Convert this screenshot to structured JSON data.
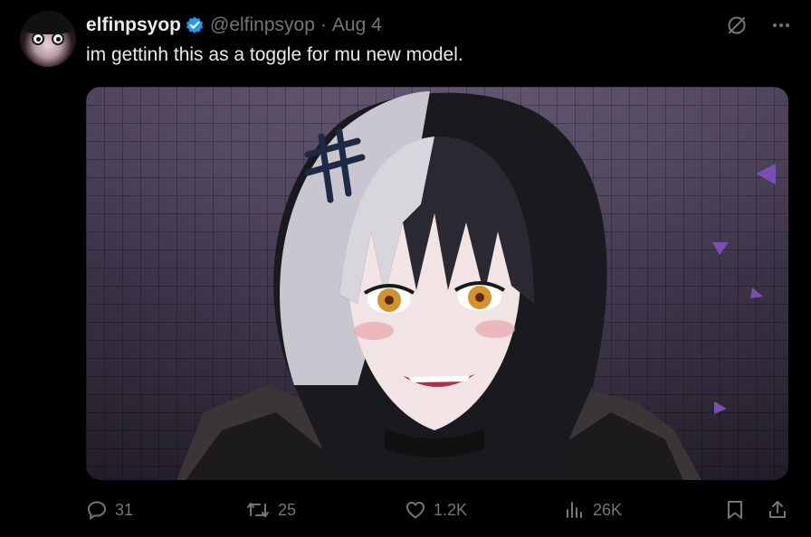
{
  "tweet": {
    "display_name": "elfinpsyop",
    "handle": "@elfinpsyop",
    "separator": "·",
    "date": "Aug 4",
    "text": "im gettinh this as a toggle for mu new model.",
    "verified": true,
    "verified_color": "#1d9bf0"
  },
  "actions": {
    "replies": "31",
    "reposts": "25",
    "likes": "1.2K",
    "views": "26K"
  },
  "icons": {
    "top_right": [
      "grok-icon",
      "more-icon"
    ],
    "actions": [
      "reply-icon",
      "repost-icon",
      "like-icon",
      "views-icon",
      "bookmark-icon",
      "share-icon"
    ]
  },
  "colors": {
    "background": "#000000",
    "text_primary": "#e7e9ea",
    "text_secondary": "#71767b"
  }
}
